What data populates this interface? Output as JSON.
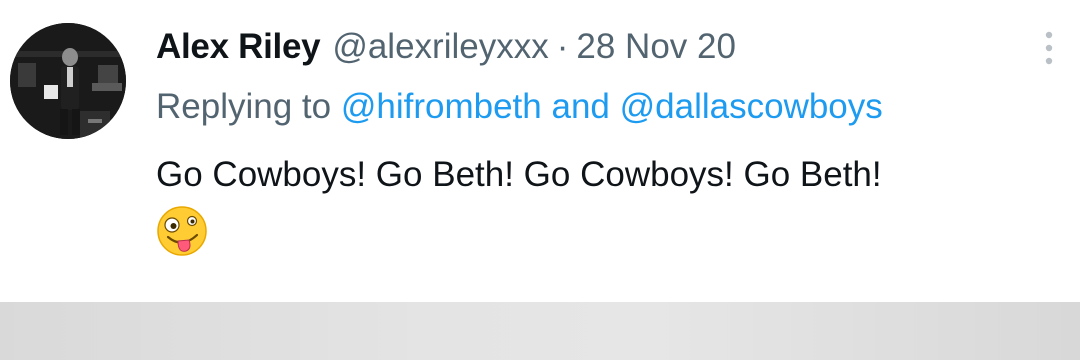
{
  "tweet": {
    "author_name": "Alex Riley",
    "handle": "@alexrileyxxx",
    "separator": "·",
    "date": "28 Nov 20",
    "replying_prefix": "Replying to",
    "reply_mentions": [
      "@hifrombeth",
      "@dallascowboys"
    ],
    "reply_conjunction": "and",
    "text": "Go Cowboys! Go Beth! Go Cowboys! Go Beth!",
    "emoji": "zany-face-emoji"
  },
  "icons": {
    "more": "more-vertical-icon",
    "avatar": "profile-photo"
  },
  "colors": {
    "text_primary": "#0f1419",
    "text_secondary": "#536471",
    "mention": "#1d9bf0",
    "bottom_band": "#e2e2e2"
  }
}
